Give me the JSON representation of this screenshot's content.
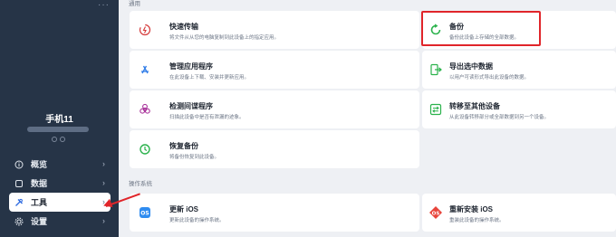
{
  "sidebar": {
    "device_name": "手机11",
    "items": [
      {
        "label": "概览",
        "icon": "info-icon"
      },
      {
        "label": "数据",
        "icon": "square-icon"
      },
      {
        "label": "工具",
        "icon": "tools-icon"
      },
      {
        "label": "设置",
        "icon": "gear-icon"
      }
    ]
  },
  "main": {
    "section_general": "通用",
    "section_os": "操作系统",
    "cards": {
      "quick_transfer": {
        "title": "快速传输",
        "desc": "将文件从从您的电脑复制到此设备上的指定应用。"
      },
      "backup": {
        "title": "备份",
        "desc": "备份此设备上存储的全部数据。"
      },
      "manage_apps": {
        "title": "管理应用程序",
        "desc": "在此设备上下载、安装并更新应用。"
      },
      "export_data": {
        "title": "导出选中数据",
        "desc": "以用户可读形式导出此设备的数据。"
      },
      "detect_spyware": {
        "title": "检测间谍程序",
        "desc": "扫描此设备中是否有泄漏的迹象。"
      },
      "transfer_device": {
        "title": "转移至其他设备",
        "desc": "从此设备转移部分或全部数据到另一个设备。"
      },
      "restore_backup": {
        "title": "恢复备份",
        "desc": "将备份恢复到此设备。"
      },
      "update_ios": {
        "title": "更新 iOS",
        "desc": "更新此设备的操作系统。"
      },
      "reinstall_ios": {
        "title": "重新安装 iOS",
        "desc": "重装此设备的操作系统。"
      }
    }
  },
  "colors": {
    "sidebar_bg": "#263447",
    "accent_red": "#e0252a",
    "main_bg": "#eef0f4"
  }
}
